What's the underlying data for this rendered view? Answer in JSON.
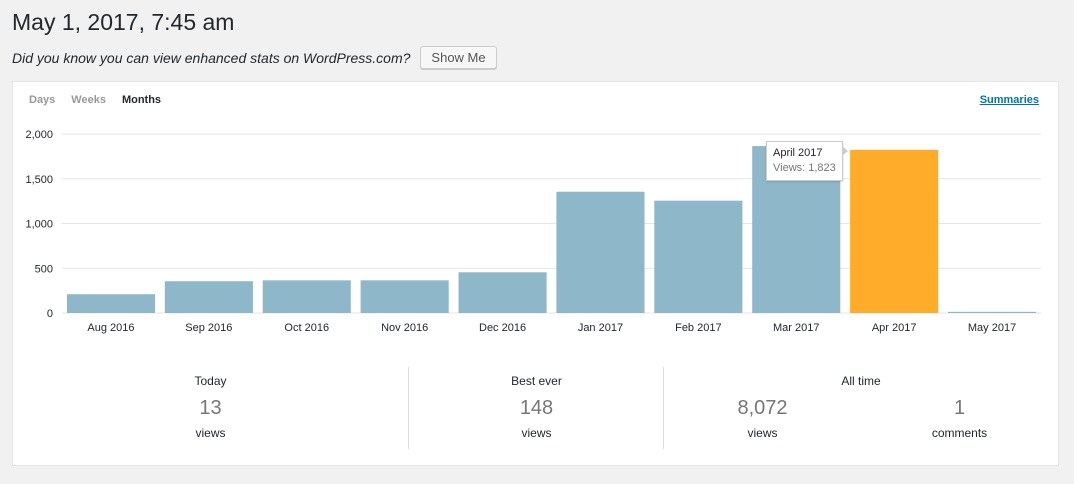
{
  "page": {
    "title": "May 1, 2017, 7:45 am",
    "promo_text": "Did you know you can view enhanced stats on WordPress.com?",
    "promo_button": "Show Me"
  },
  "tabs": {
    "days": "Days",
    "weeks": "Weeks",
    "months": "Months",
    "active": "months",
    "summaries": "Summaries"
  },
  "tooltip": {
    "title": "April 2017",
    "text": "Views: 1,823"
  },
  "colors": {
    "bar": "#8eb8c9",
    "highlight": "#ffac2a",
    "grid": "#e6e6e6",
    "axis_text": "#23282d"
  },
  "chart_data": {
    "type": "bar",
    "categories": [
      "Aug 2016",
      "Sep 2016",
      "Oct 2016",
      "Nov 2016",
      "Dec 2016",
      "Jan 2017",
      "Feb 2017",
      "Mar 2017",
      "Apr 2017",
      "May 2017"
    ],
    "values": [
      210,
      355,
      365,
      365,
      455,
      1355,
      1255,
      1865,
      1823,
      13
    ],
    "highlight_index": 8,
    "yticks": [
      "0",
      "500",
      "1,000",
      "1,500",
      "2,000"
    ],
    "ylim": [
      0,
      2000
    ],
    "grid": true
  },
  "stats": {
    "today": {
      "label": "Today",
      "value": "13",
      "unit": "views"
    },
    "best": {
      "label": "Best ever",
      "value": "148",
      "unit": "views"
    },
    "alltime": {
      "label": "All time",
      "views_value": "8,072",
      "views_unit": "views",
      "comments_value": "1",
      "comments_unit": "comments"
    }
  }
}
